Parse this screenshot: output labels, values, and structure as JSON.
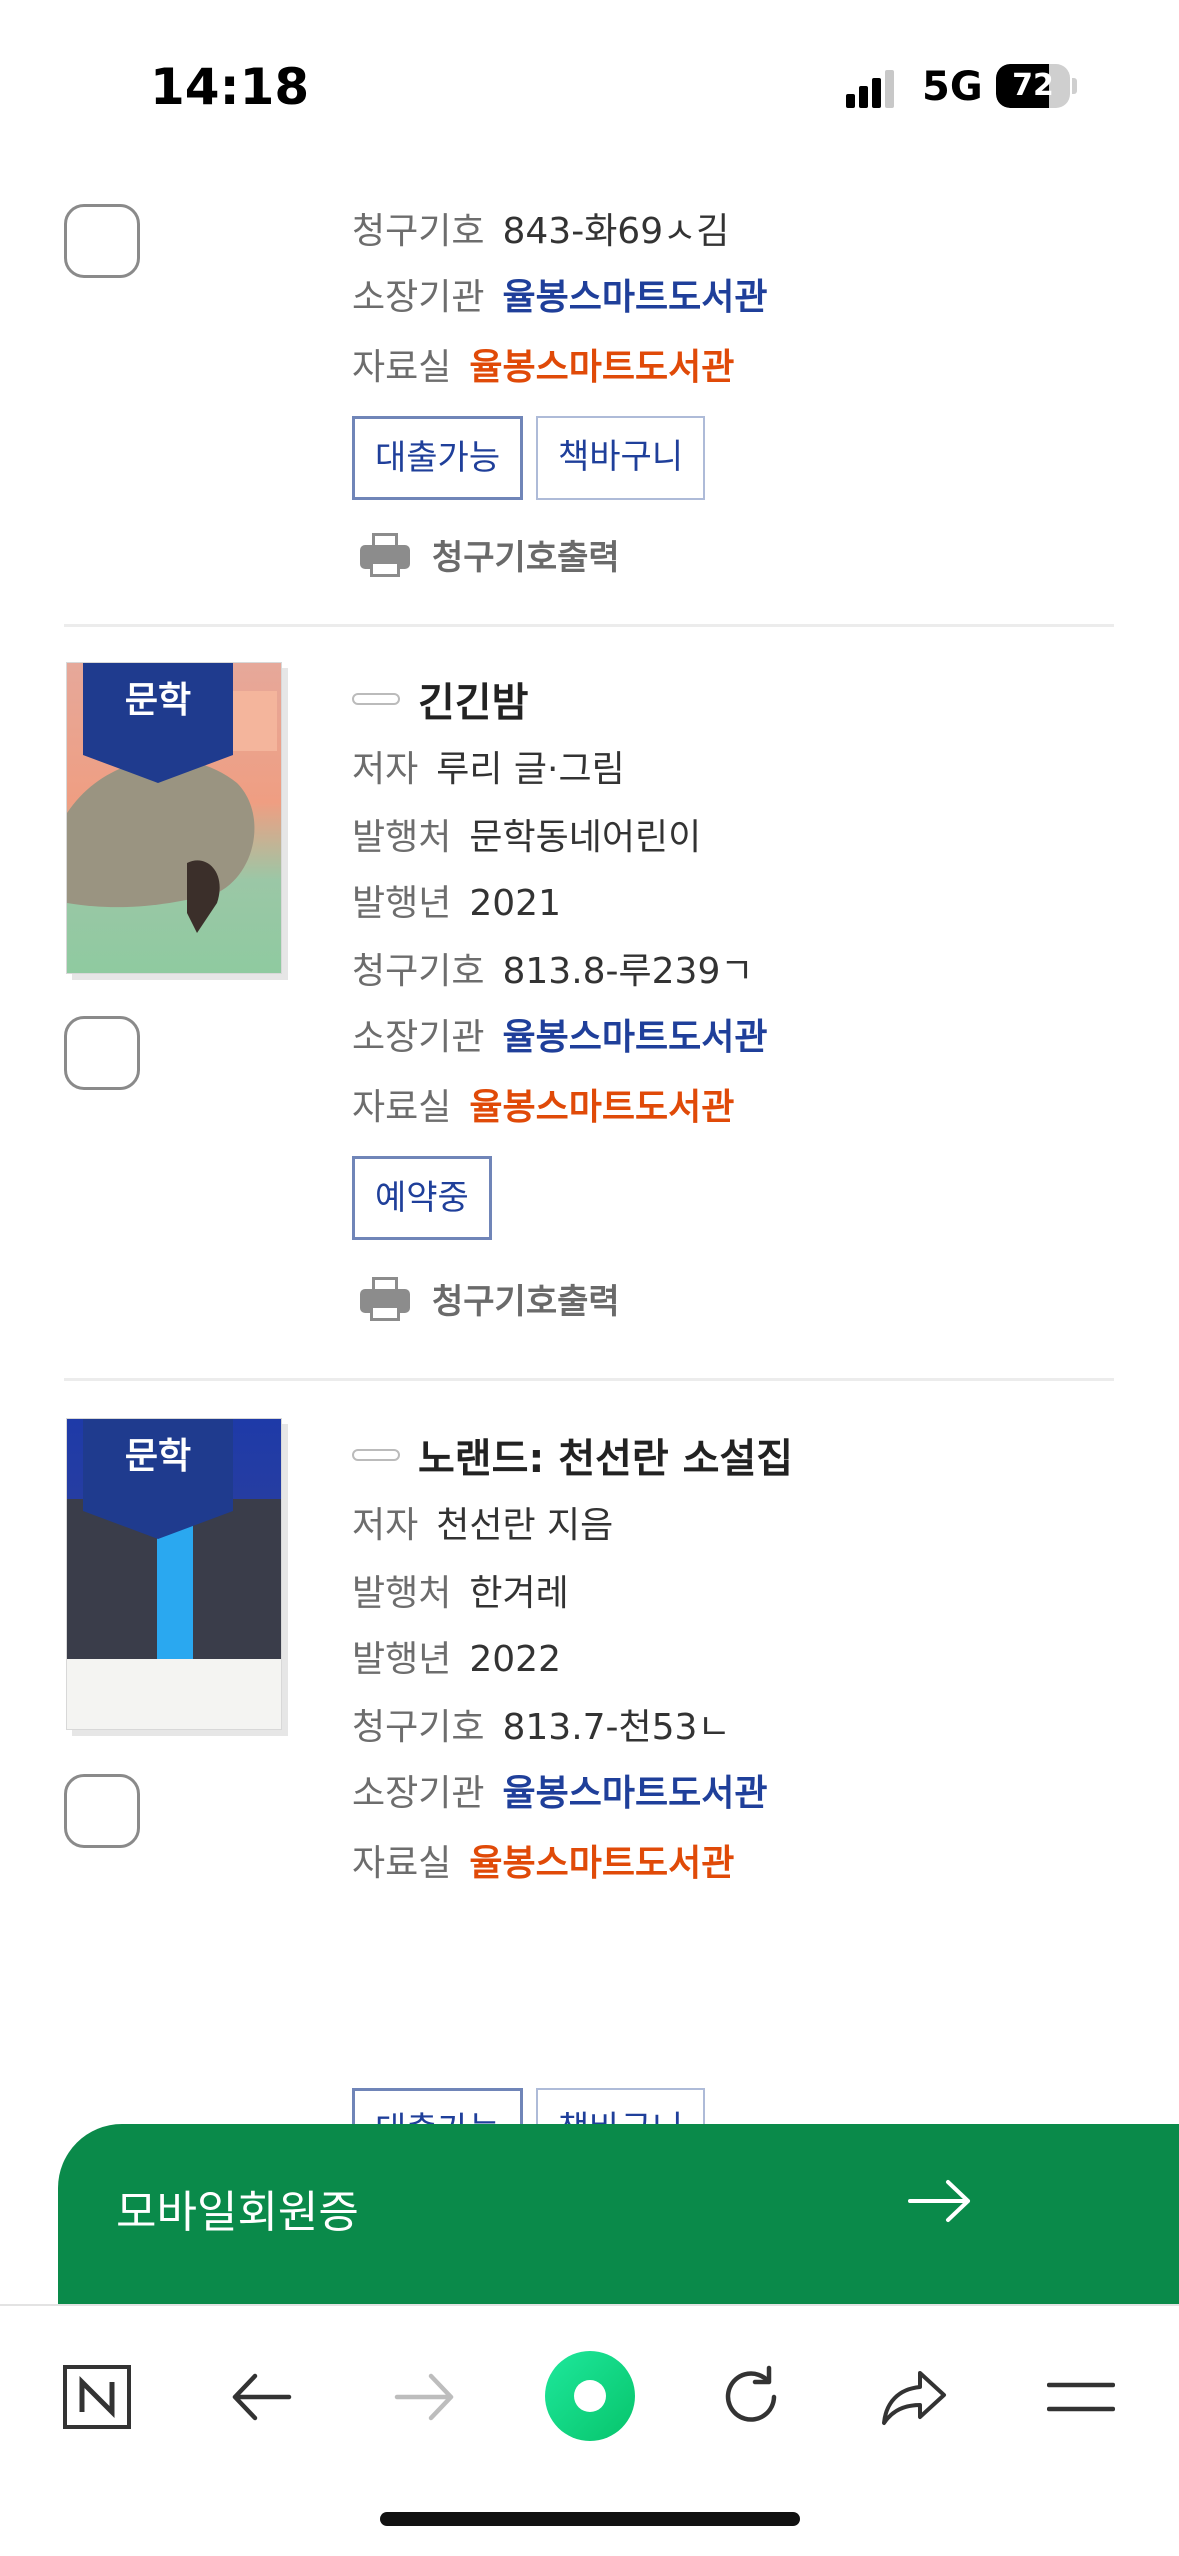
{
  "status_bar": {
    "time": "14:18",
    "network": "5G",
    "battery": "72",
    "battery_level": 0.72,
    "icons": [
      "signal-icon",
      "battery-icon"
    ]
  },
  "labels": {
    "author": "저자",
    "publisher": "발행처",
    "year": "발행년",
    "call_no": "청구기호",
    "library": "소장기관",
    "room": "자료실",
    "print": "청구기호출력"
  },
  "cover_badge": "문학",
  "books": [
    {
      "title": "",
      "call_no": "843-화69ㅅ김",
      "library": "율봉스마트도서관",
      "room": "율봉스마트도서관",
      "status": "대출가능",
      "basket": "책바구니"
    },
    {
      "title": "긴긴밤",
      "author": "루리 글·그림",
      "publisher": "문학동네어린이",
      "year": "2021",
      "call_no": "813.8-루239ㄱ",
      "library": "율봉스마트도서관",
      "room": "율봉스마트도서관",
      "status": "예약중"
    },
    {
      "title": "노랜드: 천선란 소설집",
      "author": "천선란 지음",
      "publisher": "한겨레",
      "year": "2022",
      "call_no": "813.7-천53ㄴ",
      "library": "율봉스마트도서관",
      "room": "율봉스마트도서관",
      "status": "대출가능",
      "basket": "책바구니"
    }
  ],
  "member_card": {
    "label": "모바일회원증",
    "icon": "arrow-right-icon"
  },
  "toolbar": {
    "icons": [
      "naver-home-icon",
      "back-icon",
      "forward-icon",
      "green-dot-icon",
      "reload-icon",
      "share-icon",
      "menu-icon"
    ]
  },
  "colors": {
    "accent_blue": "#1f3f9a",
    "accent_orange": "#e04a08",
    "member_green": "#0a8a4a",
    "cover_navy": "#1f3b8e"
  }
}
